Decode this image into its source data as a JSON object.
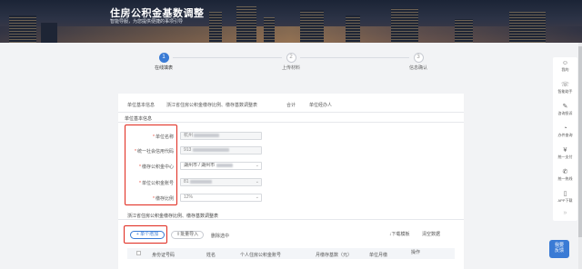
{
  "banner": {
    "title": "住房公积金基数调整",
    "subtitle": "智能导服，为您提供便捷的事项引导"
  },
  "steps": [
    {
      "num": "1",
      "label": "在线填表"
    },
    {
      "num": "2",
      "label": "上传材料"
    },
    {
      "num": "3",
      "label": "信息确认"
    }
  ],
  "tabs": [
    "单位基本信息",
    "浙江省住房公积金缴存比例、缴存基数调整表",
    "合计",
    "单位经办人"
  ],
  "form": {
    "section_title": "单位基本信息",
    "fields": [
      {
        "label": "单位名称",
        "value": "杭州"
      },
      {
        "label": "统一社会信用代码",
        "value": "913"
      },
      {
        "label": "缴存公积金中心",
        "value": "湖州市 / 湖州市"
      },
      {
        "label": "单位公积金账号",
        "value": "81"
      },
      {
        "label": "缴存比例",
        "value": "12%"
      }
    ]
  },
  "table_section": {
    "title": "浙江省住房公积金缴存比例、缴存基数调整表",
    "add_single": "+ 单个增加",
    "batch_import": "批量导入",
    "delete_selected": "删除选中",
    "download_template": "下载模板",
    "clear_data": "清空数据",
    "columns": [
      "身份证号码",
      "姓名",
      "个人住房公积金账号",
      "月缴存基数（元）",
      "单位月缴",
      "操作"
    ]
  },
  "sidebar": {
    "items": [
      {
        "icon": "user-icon",
        "glyph": "☺",
        "label": "我的"
      },
      {
        "icon": "headset-icon",
        "glyph": "☏",
        "label": "智能助手"
      },
      {
        "icon": "complaint-icon",
        "glyph": "✎",
        "label": "咨询投诉"
      },
      {
        "icon": "progress-icon",
        "glyph": "◔",
        "label": "办件查询"
      },
      {
        "icon": "pay-icon",
        "glyph": "¥",
        "label": "统一支付"
      },
      {
        "icon": "hotline-icon",
        "glyph": "✆",
        "label": "统一热线"
      },
      {
        "icon": "app-icon",
        "glyph": "▯",
        "label": "APP下载"
      }
    ],
    "more_glyph": "»"
  },
  "feedback": {
    "line1": "我要",
    "line2": "反馈"
  },
  "colors": {
    "accent": "#3a7bd5",
    "highlight_box": "#e0281c",
    "required": "#e64a3b"
  }
}
